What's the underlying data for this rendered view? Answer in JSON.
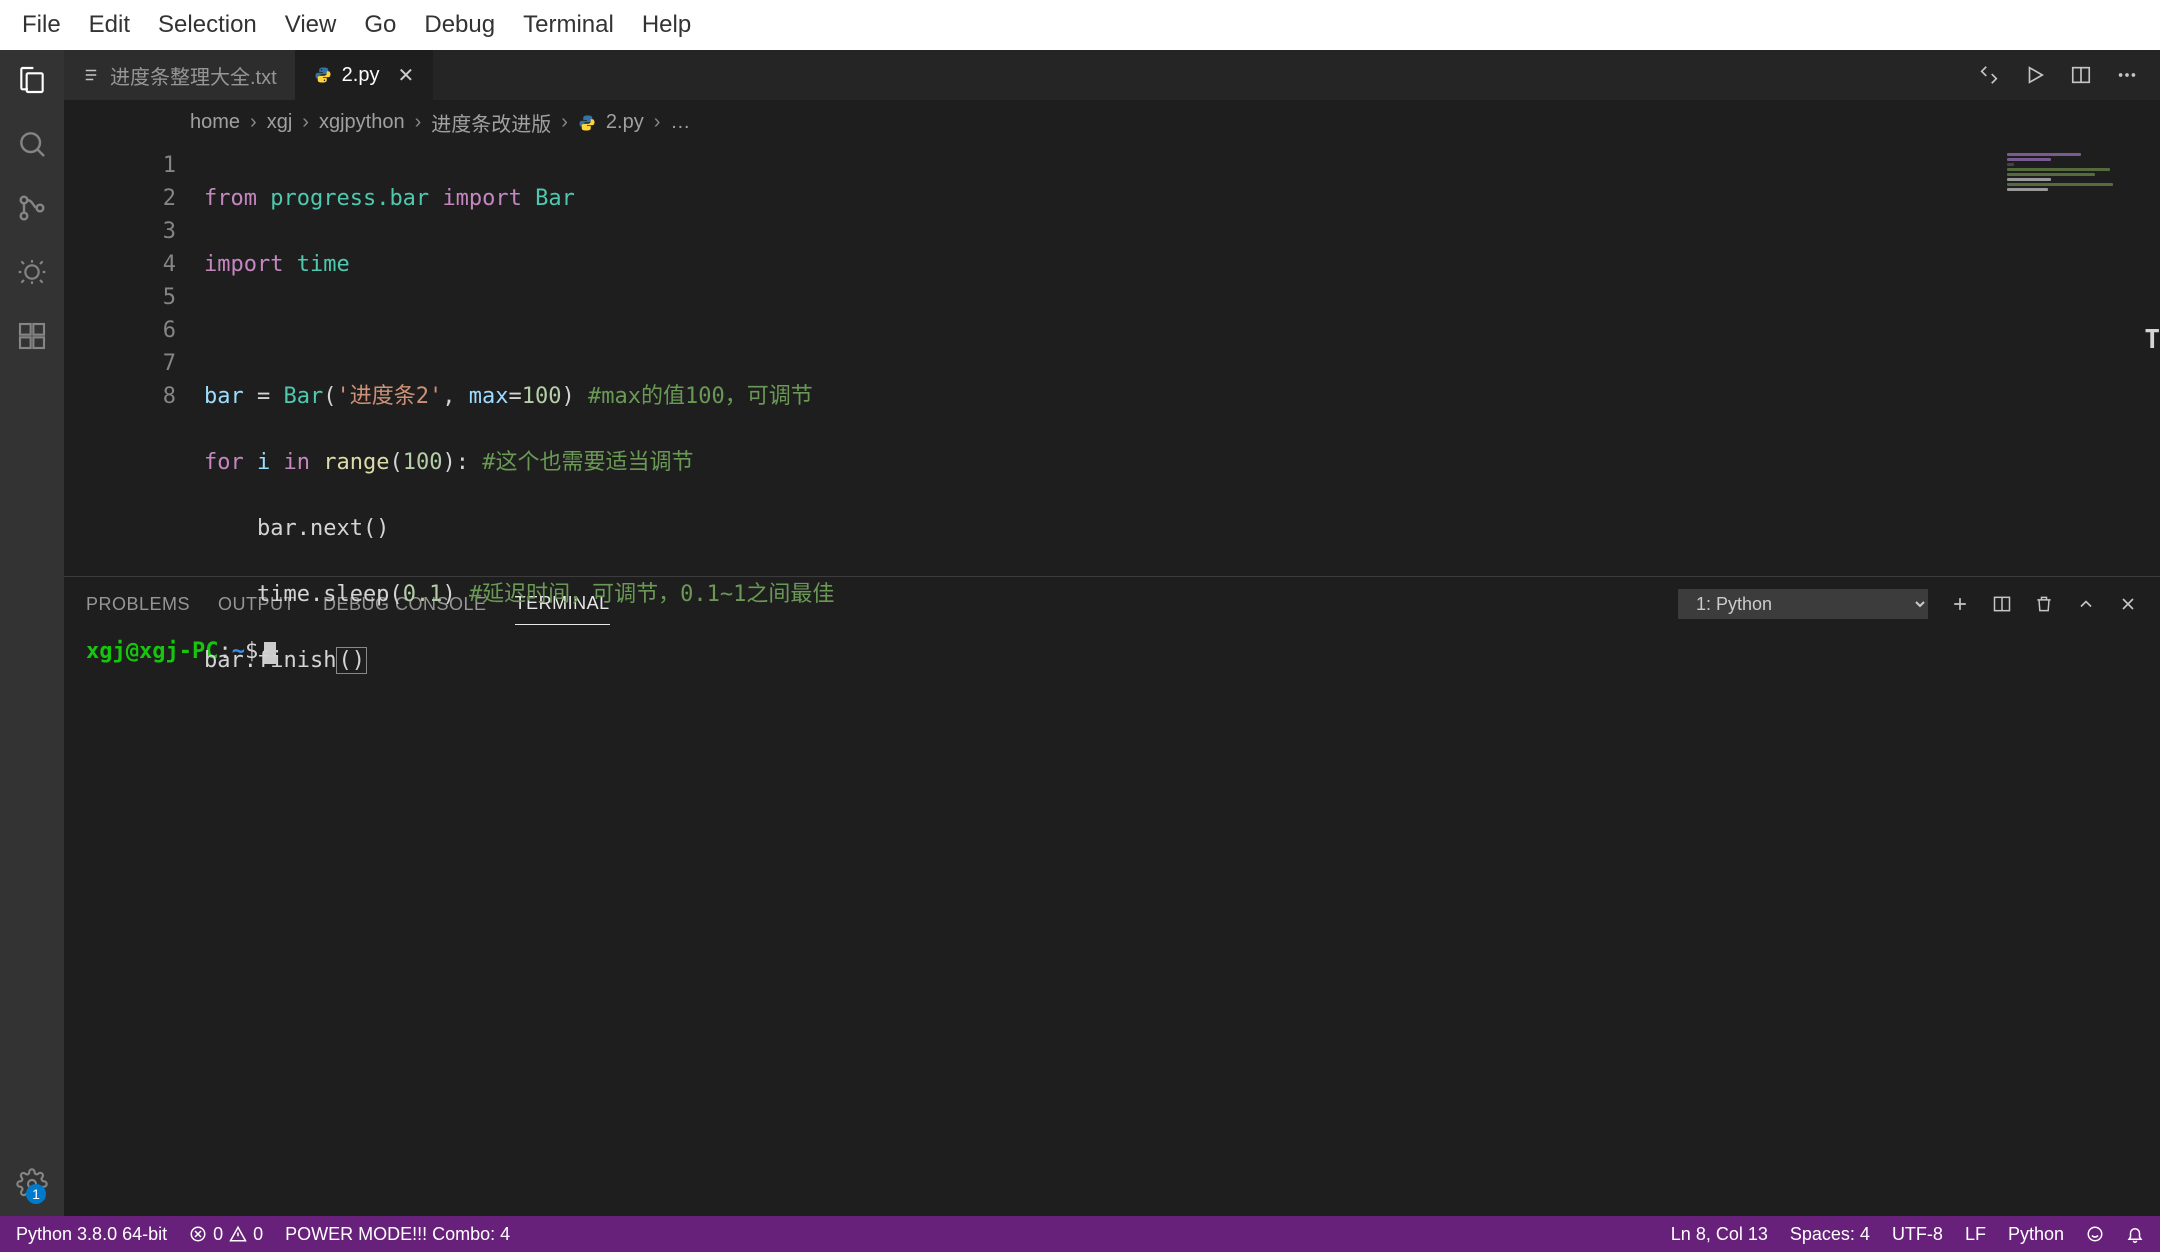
{
  "menubar": [
    "File",
    "Edit",
    "Selection",
    "View",
    "Go",
    "Debug",
    "Terminal",
    "Help"
  ],
  "activitybar": {
    "settings_badge": "1"
  },
  "tabs": [
    {
      "label": "进度条整理大全.txt",
      "active": false,
      "icon": "text"
    },
    {
      "label": "2.py",
      "active": true,
      "icon": "python",
      "closable": true
    }
  ],
  "breadcrumb": {
    "items": [
      "home",
      "xgj",
      "xgjpython",
      "进度条改进版"
    ],
    "file": "2.py",
    "trail": "…"
  },
  "code": {
    "lines": [
      1,
      2,
      3,
      4,
      5,
      6,
      7,
      8
    ]
  },
  "code_text": {
    "l1_from": "from",
    "l1_mod": "progress.bar",
    "l1_imp": "import",
    "l1_bar": "Bar",
    "l2_imp": "import",
    "l2_time": "time",
    "l4_bar": "bar",
    "l4_eq": " = ",
    "l4_Bar": "Bar",
    "l4_lp": "(",
    "l4_str": "'进度条2'",
    "l4_rest": ", ",
    "l4_max": "max",
    "l4_eq2": "=",
    "l4_num": "100",
    "l4_rp": ") ",
    "l4_cmt": "#max的值100，可调节",
    "l5_for": "for",
    "l5_i": " i ",
    "l5_in": "in",
    "l5_range": " range",
    "l5_lp": "(",
    "l5_num": "100",
    "l5_rp": "): ",
    "l5_cmt": "#这个也需要适当调节",
    "l6": "    bar.next()",
    "l7_a": "    time.sleep(",
    "l7_num": "0.1",
    "l7_b": ") ",
    "l7_cmt": "#延迟时间，可调节，0.1~1之间最佳",
    "l8_a": "bar.finish",
    "l8_b": "()"
  },
  "panel": {
    "tabs": [
      "PROBLEMS",
      "OUTPUT",
      "DEBUG CONSOLE",
      "TERMINAL"
    ],
    "active": "TERMINAL",
    "terminal_select": "1: Python"
  },
  "terminal": {
    "user": "xgj@xgj-PC",
    "path": "~",
    "prompt": "$"
  },
  "statusbar": {
    "python": "Python 3.8.0 64-bit",
    "errors": "0",
    "warnings": "0",
    "powermode": "POWER MODE!!! Combo: 4",
    "lncol": "Ln 8, Col 13",
    "spaces": "Spaces: 4",
    "encoding": "UTF-8",
    "eol": "LF",
    "lang": "Python"
  }
}
